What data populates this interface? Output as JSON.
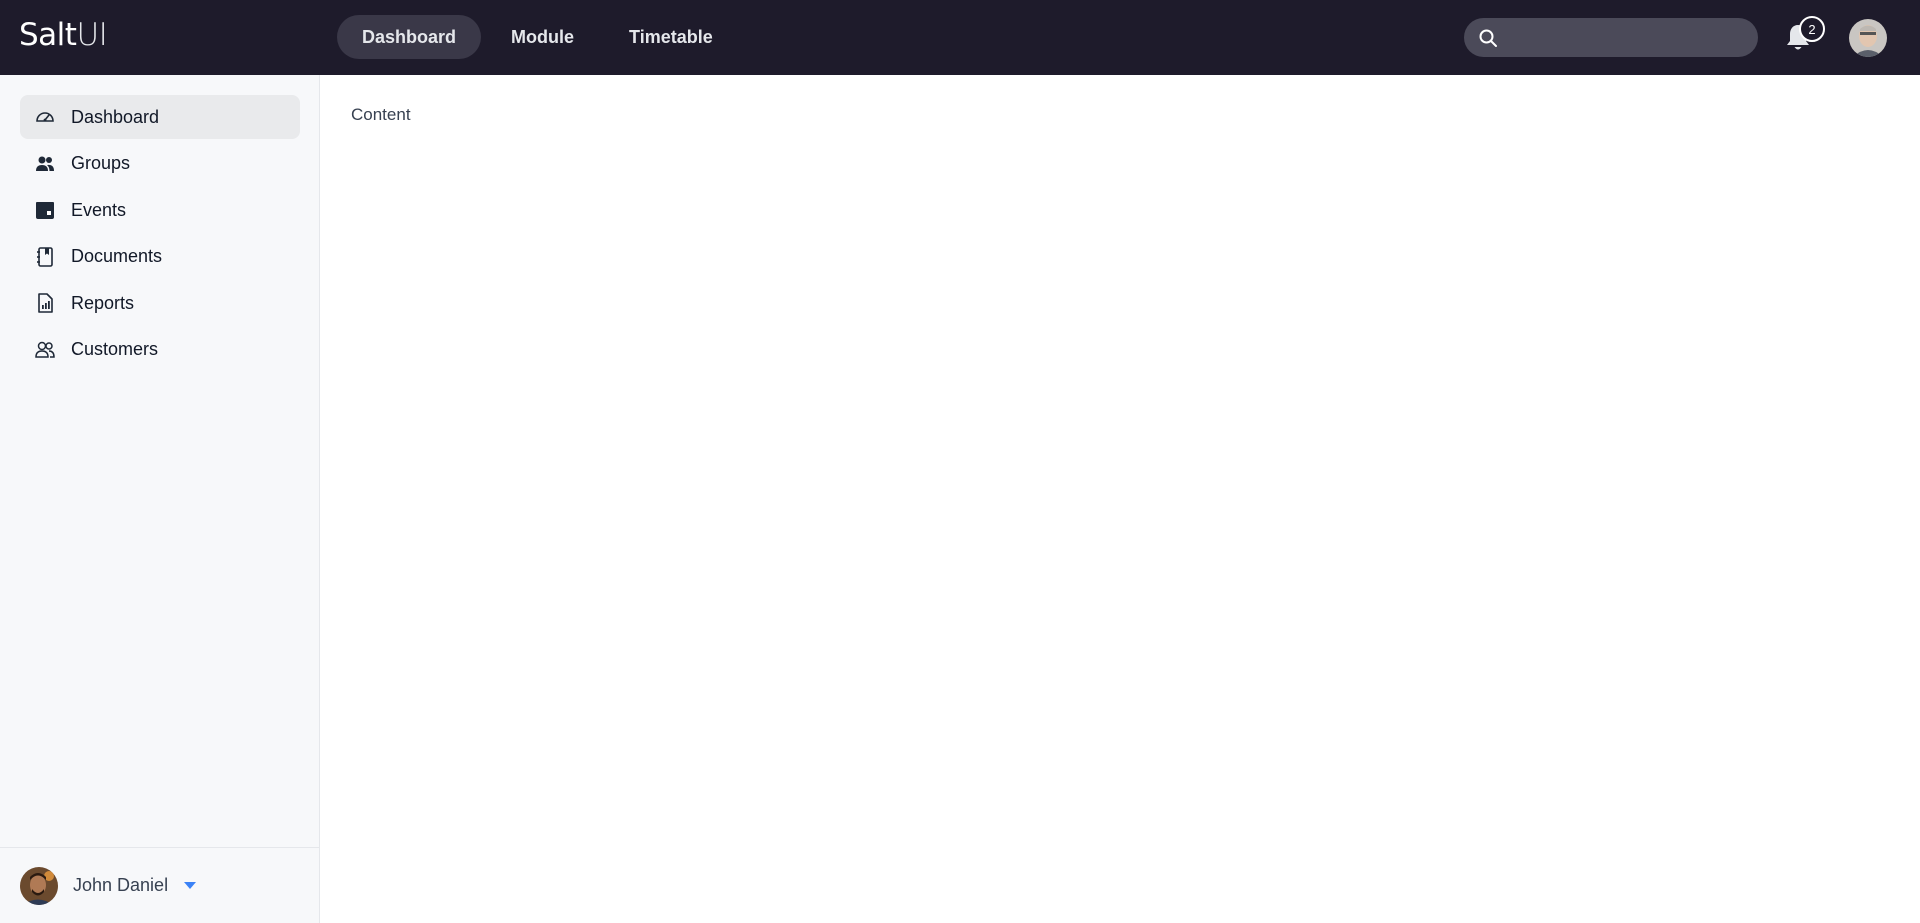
{
  "app": {
    "logo_bold": "Salt",
    "logo_light": "UI"
  },
  "topnav": {
    "items": [
      {
        "label": "Dashboard",
        "active": true
      },
      {
        "label": "Module",
        "active": false
      },
      {
        "label": "Timetable",
        "active": false
      }
    ]
  },
  "search": {
    "placeholder": "",
    "icon": "search-icon"
  },
  "notifications": {
    "count": "2",
    "icon": "bell-icon"
  },
  "sidebar": {
    "items": [
      {
        "label": "Dashboard",
        "icon": "dashboard-gauge-icon",
        "active": true
      },
      {
        "label": "Groups",
        "icon": "groups-icon",
        "active": false
      },
      {
        "label": "Events",
        "icon": "calendar-icon",
        "active": false
      },
      {
        "label": "Documents",
        "icon": "documents-icon",
        "active": false
      },
      {
        "label": "Reports",
        "icon": "report-icon",
        "active": false
      },
      {
        "label": "Customers",
        "icon": "customers-icon",
        "active": false
      }
    ],
    "user": {
      "name": "John Daniel",
      "caret_color": "#3b82f6"
    }
  },
  "main": {
    "content_text": "Content"
  },
  "colors": {
    "topbar_bg": "#1e1b2b",
    "active_nav_bg": "#3a3848",
    "sidebar_bg": "#f7f8fa",
    "sidebar_active_bg": "#e9eaec"
  }
}
